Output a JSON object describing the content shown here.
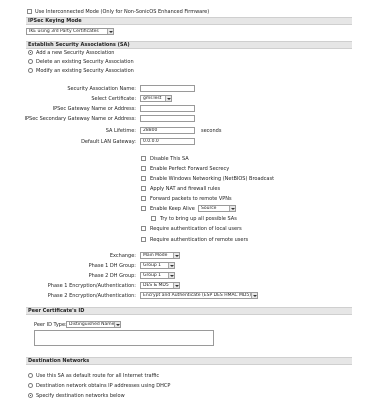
{
  "top_option": {
    "label": "Use Interconnected Mode (Only for Non-SonicOS Enhanced Firmware)",
    "checked": false
  },
  "ipsec_keying": {
    "section_title": "IPSec Keying Mode",
    "mode_value": "IKE using 3rd Party Certificates"
  },
  "sa": {
    "section_title": "Establish Security Associations (SA)",
    "radios": [
      {
        "label": "Add a new Security Association",
        "selected": true
      },
      {
        "label": "Delete an existing Security Association",
        "selected": false
      },
      {
        "label": "Modify an existing Security Association",
        "selected": false
      }
    ],
    "fields": {
      "sa_name_label": "Security Association Name:",
      "sa_name_value": "",
      "select_cert_label": "Select Certificate:",
      "select_cert_value": "gmsTest",
      "gateway_label": "IPSec Gateway Name or Address:",
      "gateway_value": "",
      "secondary_gateway_label": "IPSec Secondary Gateway Name or Address:",
      "secondary_gateway_value": "",
      "lifetime_label": "SA Lifetime:",
      "lifetime_value": "28800",
      "lifetime_unit": "seconds",
      "lan_gateway_label": "Default LAN Gateway:",
      "lan_gateway_value": "0.0.0.0"
    },
    "options": [
      {
        "label": "Disable This SA",
        "checked": false
      },
      {
        "label": "Enable Perfect Forward Secrecy",
        "checked": false
      },
      {
        "label": "Enable Windows Networking (NetBIOS) Broadcast",
        "checked": false
      },
      {
        "label": "Apply NAT and firewall rules",
        "checked": false
      },
      {
        "label": "Forward packets to remote VPNs",
        "checked": false
      },
      {
        "label": "Enable Keep Alive",
        "checked": false
      },
      {
        "label": "Try to bring up all possible SAs",
        "checked": false
      },
      {
        "label": "Require authentication of local users",
        "checked": false
      },
      {
        "label": "Require authentication of remote users",
        "checked": false
      }
    ],
    "keep_alive_select": "Source",
    "phase": {
      "exchange_label": "Exchange:",
      "exchange_value": "Main Mode",
      "p1_dh_label": "Phase 1 DH Group:",
      "p1_dh_value": "Group 1",
      "p2_dh_label": "Phase 2 DH Group:",
      "p2_dh_value": "Group 1",
      "p1_enc_label": "Phase 1 Encryption/Authentication:",
      "p1_enc_value": "DES & MD5",
      "p2_enc_label": "Phase 2 Encryption/Authentication:",
      "p2_enc_value": "Encrypt and Authenticate (ESP DES HMAC MD5)"
    }
  },
  "peer_cert": {
    "section_title": "Peer Certificate's ID",
    "peer_id_label": "Peer ID Type:",
    "peer_id_value": "Distinguished Name"
  },
  "dest": {
    "section_title": "Destination Networks",
    "radios": [
      {
        "label": "Use this SA as default route for all Internet traffic",
        "selected": false
      },
      {
        "label": "Destination network obtains IP addresses using DHCP",
        "selected": false
      },
      {
        "label": "Specify destination networks below",
        "selected": true
      }
    ]
  }
}
